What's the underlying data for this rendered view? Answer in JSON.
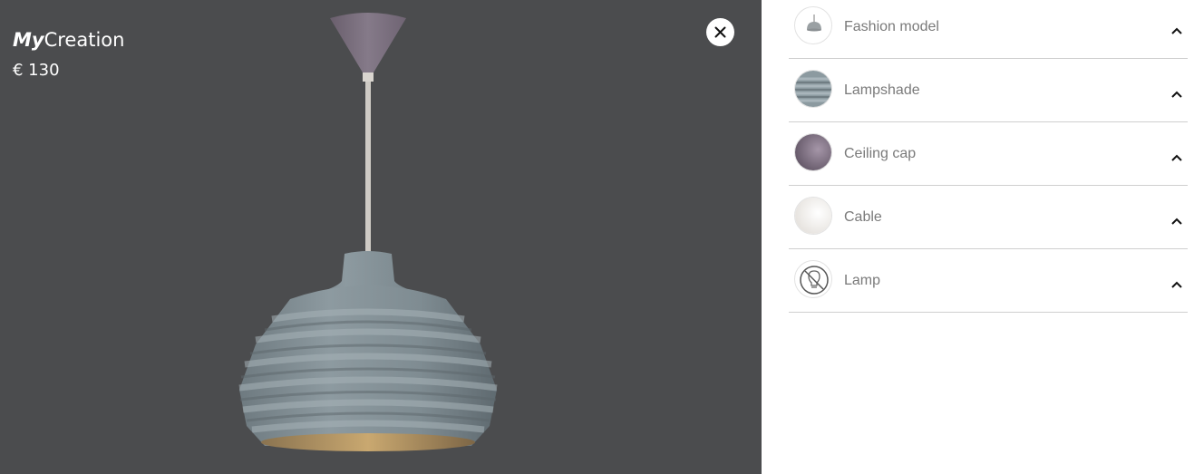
{
  "brand": {
    "prefix": "My",
    "name": "Creation"
  },
  "price": "€ 130",
  "viewer": {
    "background": "#4b4c4e"
  },
  "close_icon": "close-icon",
  "options": [
    {
      "label": "Fashion model",
      "icon": "fashion-model-icon",
      "expanded": true
    },
    {
      "label": "Lampshade",
      "icon": "lampshade-swatch-icon",
      "swatch": "#8c9aa0",
      "expanded": true
    },
    {
      "label": "Ceiling cap",
      "icon": "ceiling-cap-swatch-icon",
      "swatch": "#7b6d80",
      "expanded": true
    },
    {
      "label": "Cable",
      "icon": "cable-swatch-icon",
      "swatch": "#f1efec",
      "expanded": true
    },
    {
      "label": "Lamp",
      "icon": "no-bulb-icon",
      "expanded": true
    }
  ]
}
